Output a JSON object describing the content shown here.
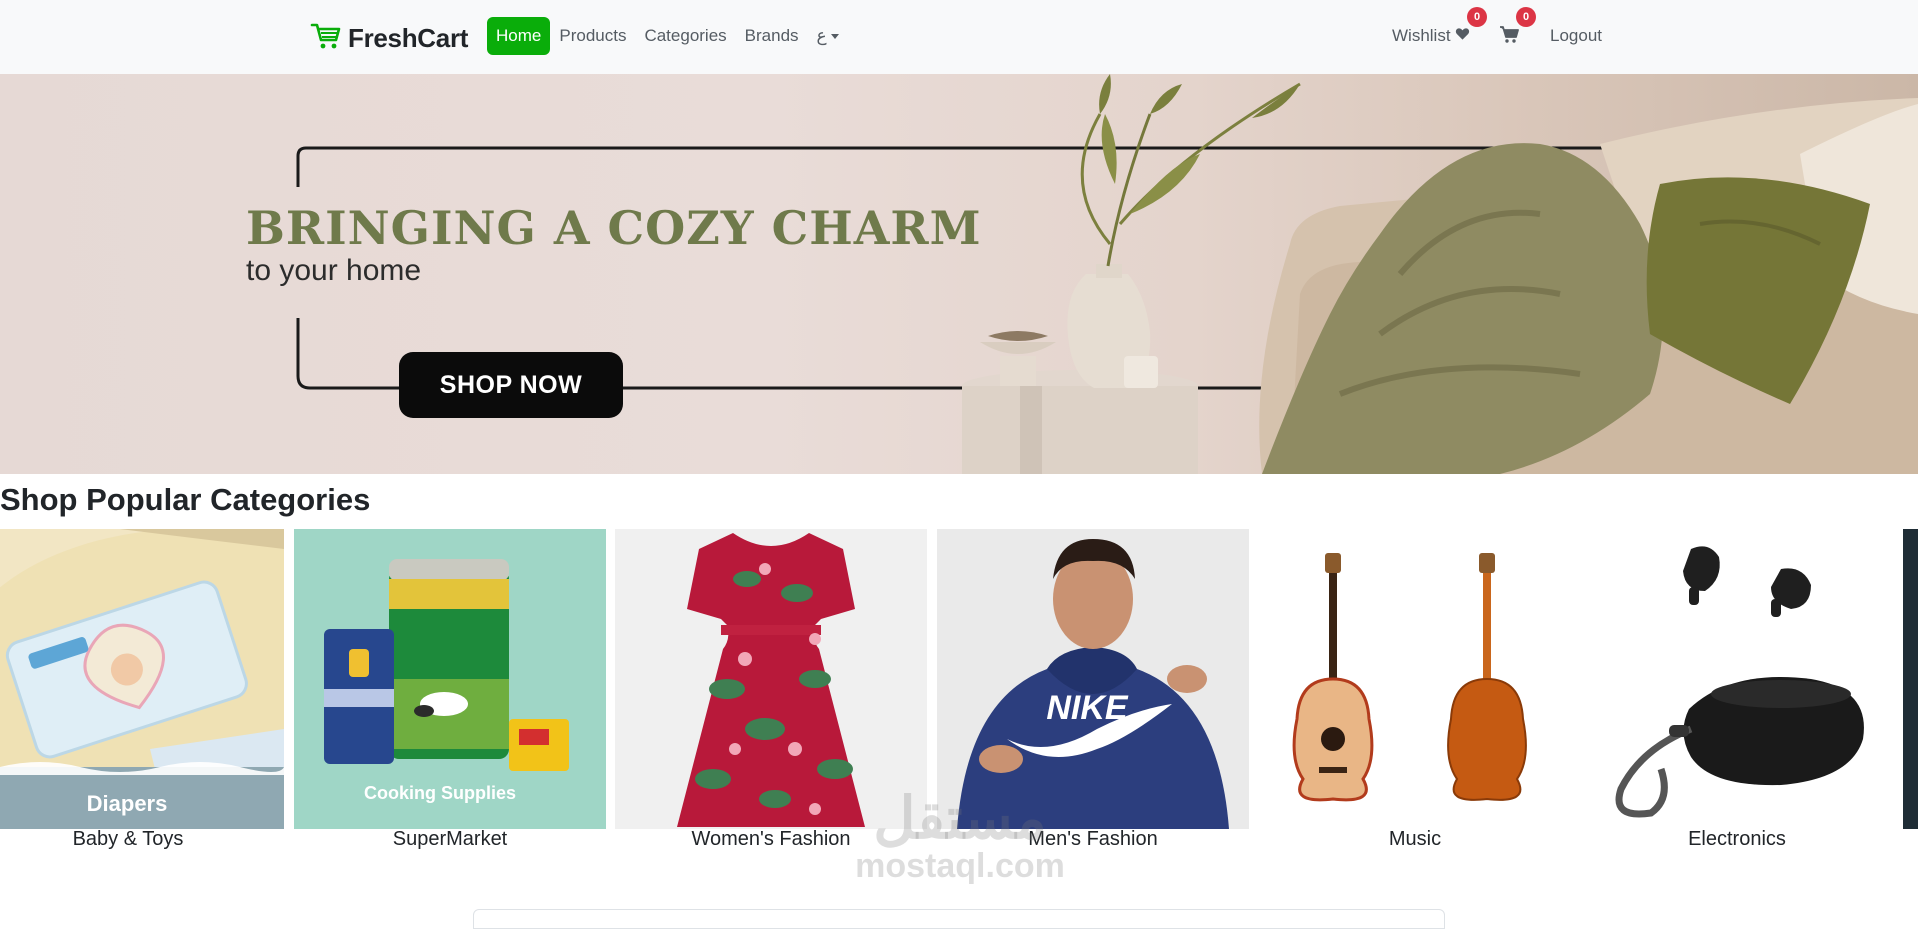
{
  "navbar": {
    "brand_name": "FreshCart",
    "links": [
      "Home",
      "Products",
      "Categories",
      "Brands"
    ],
    "lang_label": "ع",
    "wishlist_label": "Wishlist",
    "wishlist_count": "0",
    "cart_count": "0",
    "logout_label": "Logout",
    "active_color": "#0aad0a",
    "badge_color": "#dc3545"
  },
  "hero": {
    "title": "BRINGING A COZY CHARM",
    "subtitle": "to your home",
    "button_label": "SHOP NOW"
  },
  "categories": {
    "section_title": "Shop Popular Categories",
    "items": [
      {
        "name": "Baby & Toys",
        "image_text": "Diapers"
      },
      {
        "name": "SuperMarket",
        "image_text": "Cooking Supplies"
      },
      {
        "name": "Women's Fashion",
        "image_text": ""
      },
      {
        "name": "Men's Fashion",
        "image_text": "NIKE"
      },
      {
        "name": "Music",
        "image_text": ""
      },
      {
        "name": "Electronics",
        "image_text": ""
      }
    ]
  },
  "watermark": {
    "arabic": "مستقل",
    "latin": "mostaql.com"
  },
  "icons": {
    "brand": "cart-icon",
    "wishlist": "heart-icon",
    "cart": "shopping-cart-icon",
    "lang": "chevron-down-icon"
  }
}
